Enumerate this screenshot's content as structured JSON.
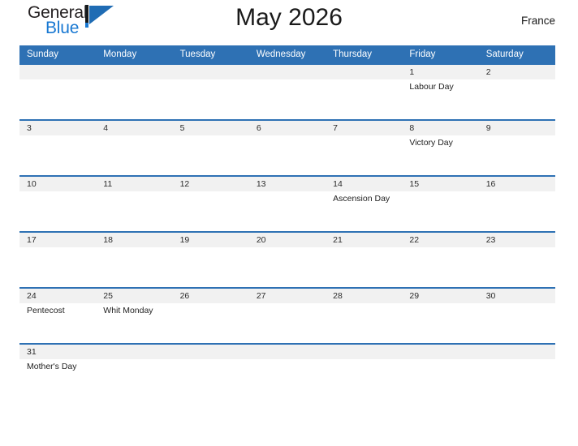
{
  "brand": {
    "name_part1": "General",
    "name_part2": "Blue",
    "mark_icon": "flag-triangle-icon",
    "accent_color": "#1878d2",
    "dark_color": "#231f20"
  },
  "header": {
    "title": "May 2026",
    "country": "France"
  },
  "calendar": {
    "header_bg": "#2e71b4",
    "daynum_bg": "#f1f1f1",
    "weekday_headers": [
      "Sunday",
      "Monday",
      "Tuesday",
      "Wednesday",
      "Thursday",
      "Friday",
      "Saturday"
    ],
    "weeks": [
      [
        {
          "date": "",
          "event": ""
        },
        {
          "date": "",
          "event": ""
        },
        {
          "date": "",
          "event": ""
        },
        {
          "date": "",
          "event": ""
        },
        {
          "date": "",
          "event": ""
        },
        {
          "date": "1",
          "event": "Labour Day"
        },
        {
          "date": "2",
          "event": ""
        }
      ],
      [
        {
          "date": "3",
          "event": ""
        },
        {
          "date": "4",
          "event": ""
        },
        {
          "date": "5",
          "event": ""
        },
        {
          "date": "6",
          "event": ""
        },
        {
          "date": "7",
          "event": ""
        },
        {
          "date": "8",
          "event": "Victory Day"
        },
        {
          "date": "9",
          "event": ""
        }
      ],
      [
        {
          "date": "10",
          "event": ""
        },
        {
          "date": "11",
          "event": ""
        },
        {
          "date": "12",
          "event": ""
        },
        {
          "date": "13",
          "event": ""
        },
        {
          "date": "14",
          "event": "Ascension Day"
        },
        {
          "date": "15",
          "event": ""
        },
        {
          "date": "16",
          "event": ""
        }
      ],
      [
        {
          "date": "17",
          "event": ""
        },
        {
          "date": "18",
          "event": ""
        },
        {
          "date": "19",
          "event": ""
        },
        {
          "date": "20",
          "event": ""
        },
        {
          "date": "21",
          "event": ""
        },
        {
          "date": "22",
          "event": ""
        },
        {
          "date": "23",
          "event": ""
        }
      ],
      [
        {
          "date": "24",
          "event": "Pentecost"
        },
        {
          "date": "25",
          "event": "Whit Monday"
        },
        {
          "date": "26",
          "event": ""
        },
        {
          "date": "27",
          "event": ""
        },
        {
          "date": "28",
          "event": ""
        },
        {
          "date": "29",
          "event": ""
        },
        {
          "date": "30",
          "event": ""
        }
      ],
      [
        {
          "date": "31",
          "event": "Mother's Day"
        },
        {
          "date": "",
          "event": ""
        },
        {
          "date": "",
          "event": ""
        },
        {
          "date": "",
          "event": ""
        },
        {
          "date": "",
          "event": ""
        },
        {
          "date": "",
          "event": ""
        },
        {
          "date": "",
          "event": ""
        }
      ]
    ]
  }
}
